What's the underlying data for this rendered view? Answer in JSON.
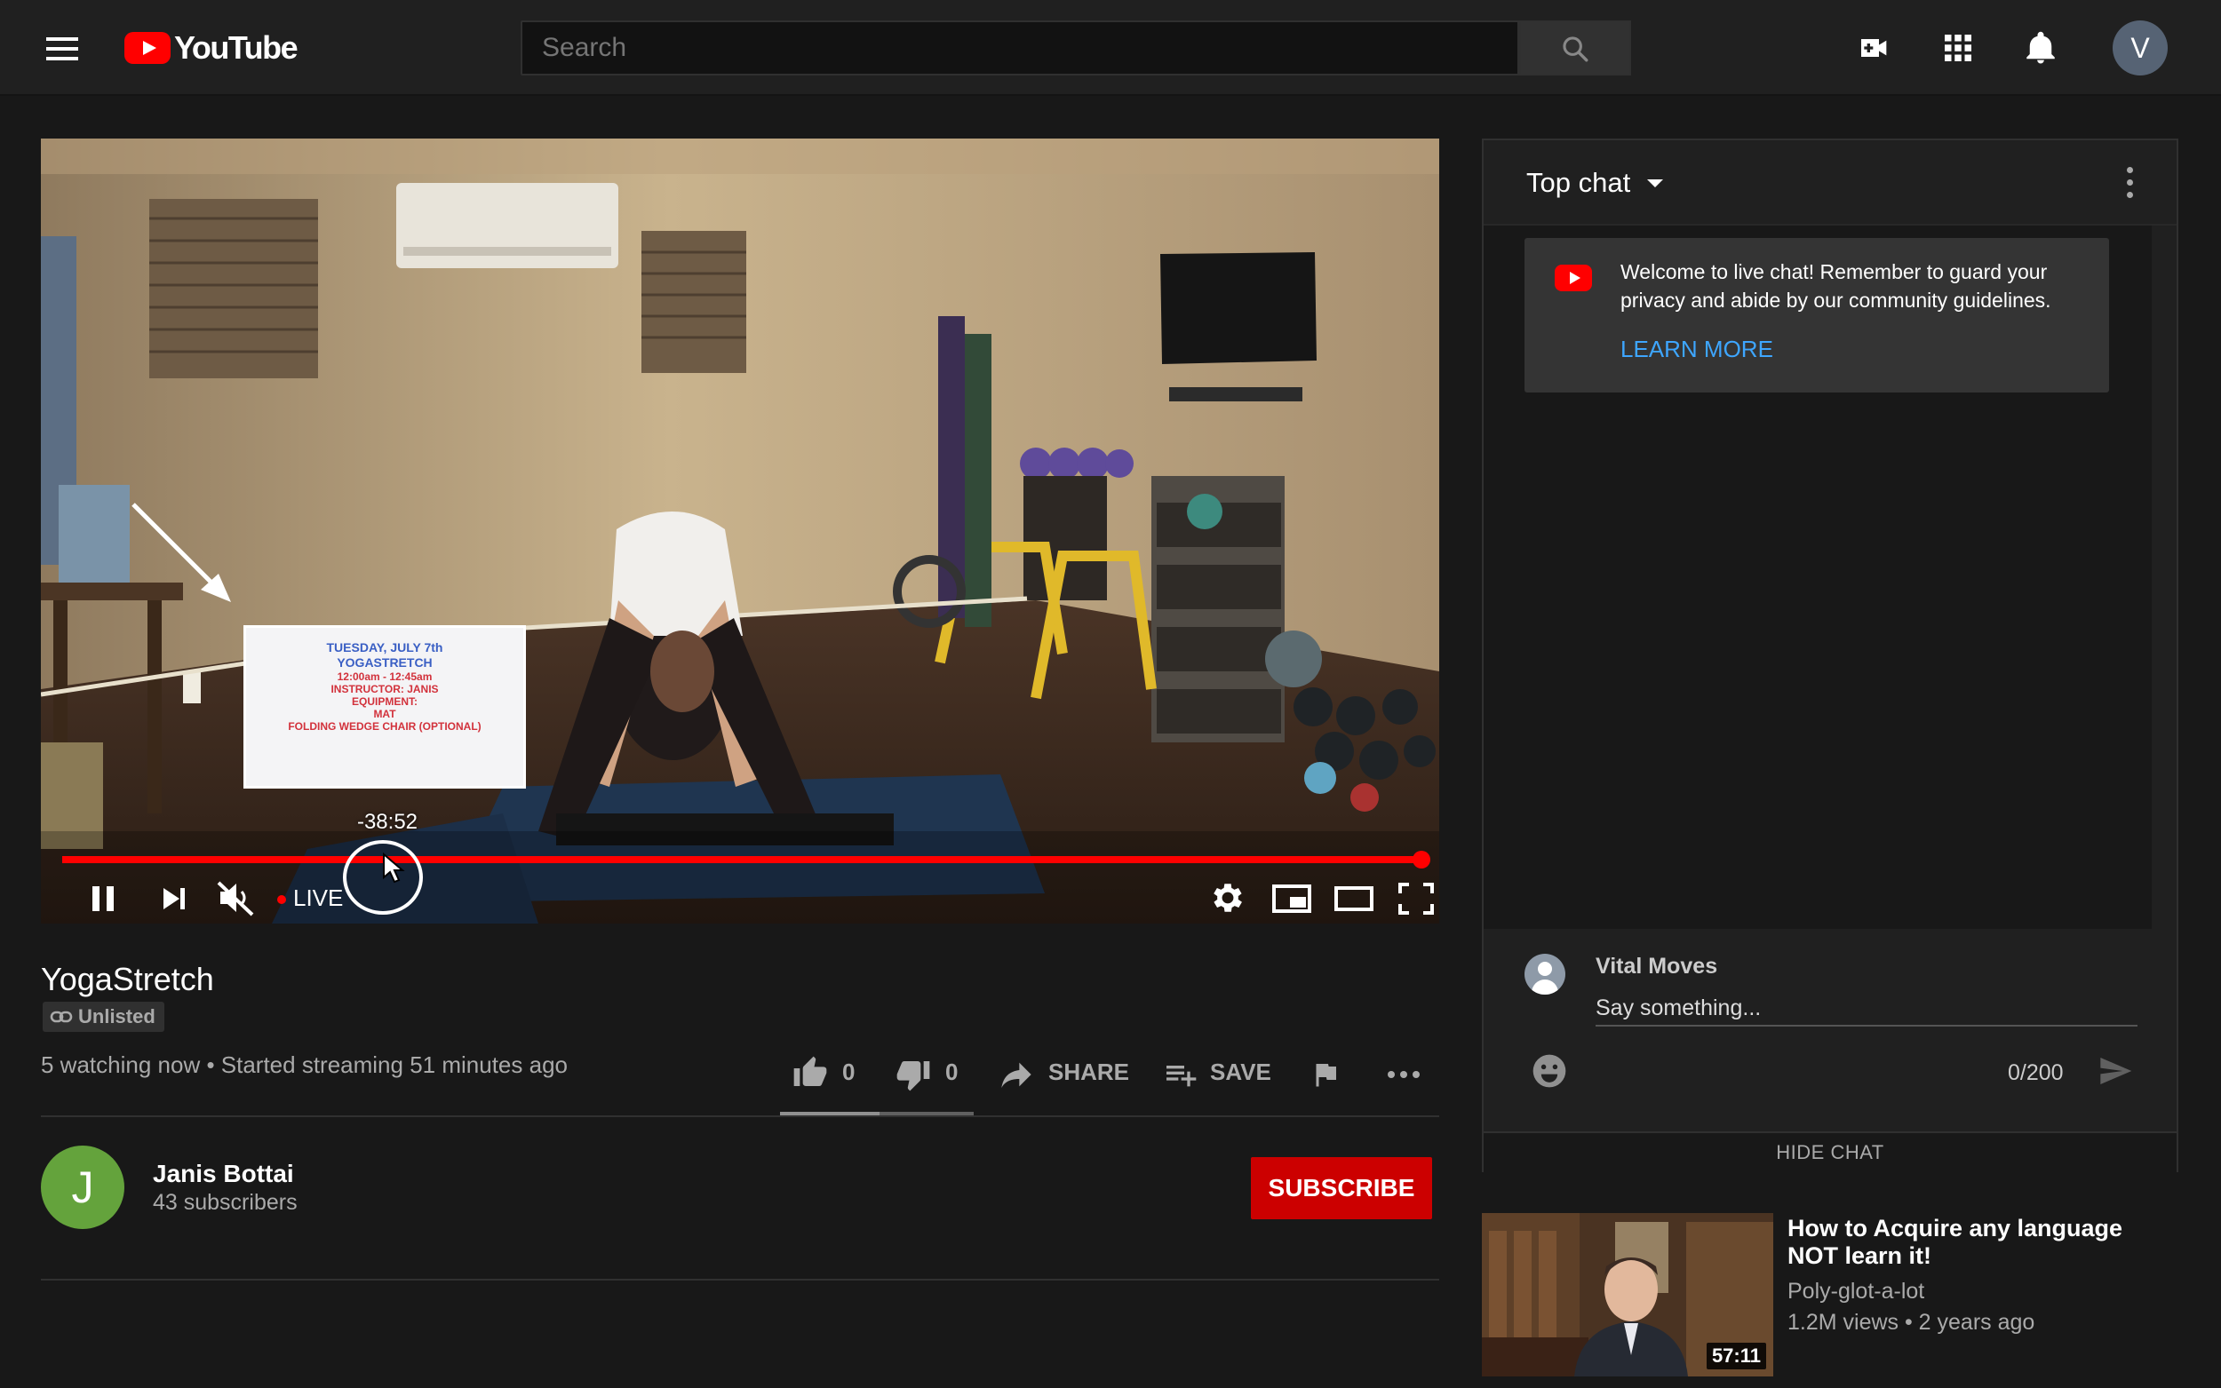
{
  "header": {
    "logo_text": "YouTube",
    "search_placeholder": "Search",
    "avatar_letter": "V"
  },
  "player": {
    "preview_lines": [
      "TUESDAY, JULY 7th",
      "YOGASTRETCH",
      "12:00am - 12:45am",
      "INSTRUCTOR: JANIS",
      "EQUIPMENT:",
      "MAT",
      "FOLDING WEDGE CHAIR (OPTIONAL)"
    ],
    "hover_time": "-38:52",
    "live_label": "LIVE",
    "progress": 1.0,
    "live_color": "#ff0000"
  },
  "video": {
    "title": "YogaStretch",
    "privacy_badge": "Unlisted",
    "meta": "5 watching now • Started streaming 51 minutes ago",
    "likes": "0",
    "dislikes": "0",
    "share_label": "SHARE",
    "save_label": "SAVE"
  },
  "channel": {
    "avatar_letter": "J",
    "avatar_color": "#64a33c",
    "name": "Janis Bottai",
    "subscribers": "43 subscribers",
    "subscribe_label": "SUBSCRIBE"
  },
  "chat": {
    "title": "Top chat",
    "welcome_message": "Welcome to live chat! Remember to guard your privacy and abide by our community guidelines.",
    "learn_more": "LEARN MORE",
    "user_name": "Vital Moves",
    "input_placeholder": "Say something...",
    "char_count": "0/200",
    "hide_chat": "HIDE CHAT",
    "link_color": "#3ea6ff"
  },
  "recommendation": {
    "title": "How to Acquire any language NOT learn it!",
    "channel": "Poly-glot-a-lot",
    "meta": "1.2M views • 2 years ago",
    "duration": "57:11"
  }
}
